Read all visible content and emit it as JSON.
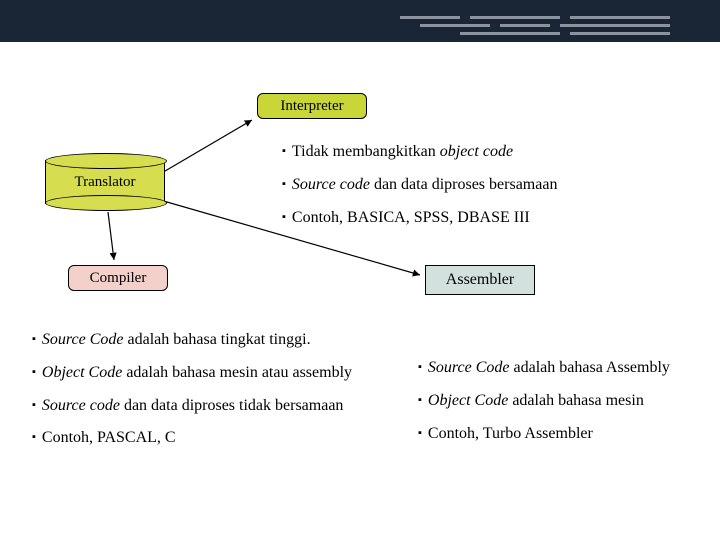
{
  "nodes": {
    "interpreter": "Interpreter",
    "translator": "Translator",
    "compiler": "Compiler",
    "assembler": "Assembler"
  },
  "interpreter_bullets": [
    {
      "pre": "Tidak membangkitkan ",
      "it": "object code",
      "post": ""
    },
    {
      "pre": "",
      "it": "Source code",
      "post": " dan data diproses bersamaan"
    },
    {
      "pre": "Contoh, BASICA, SPSS, DBASE III",
      "it": "",
      "post": ""
    }
  ],
  "compiler_bullets": [
    {
      "pre": "",
      "it": "Source Code",
      "post": " adalah bahasa tingkat tinggi."
    },
    {
      "pre": "",
      "it": "Object Code",
      "post": " adalah bahasa mesin atau assembly"
    },
    {
      "pre": "",
      "it": "Source code",
      "post": " dan data diproses tidak bersamaan"
    },
    {
      "pre": "Contoh, PASCAL, C",
      "it": "",
      "post": ""
    }
  ],
  "assembler_bullets": [
    {
      "pre": "",
      "it": "Source Code",
      "post": " adalah bahasa Assembly"
    },
    {
      "pre": "",
      "it": "Object Code",
      "post": " adalah bahasa mesin"
    },
    {
      "pre": "Contoh, Turbo Assembler",
      "it": "",
      "post": ""
    }
  ]
}
